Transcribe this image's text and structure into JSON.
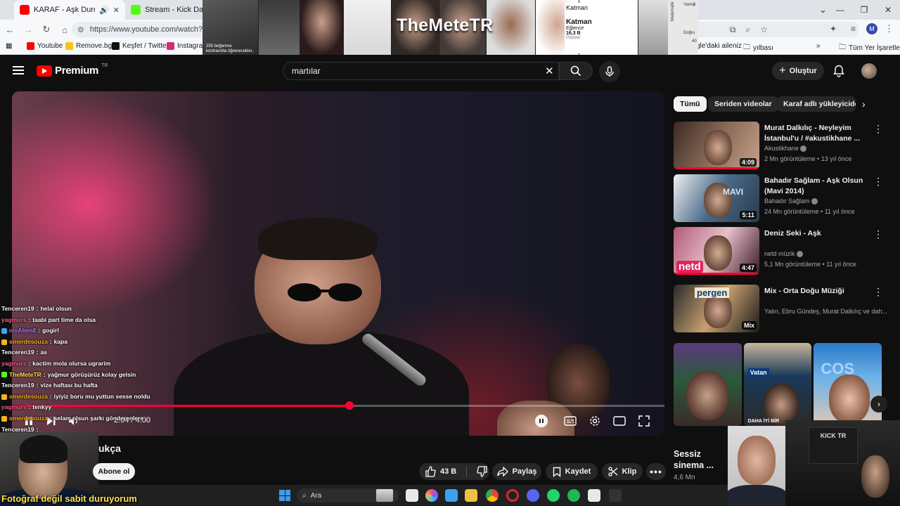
{
  "browser": {
    "tabs": [
      {
        "label": "KARAF - Aşk Durdukça - Yo",
        "active": true
      },
      {
        "label": "Stream - Kick Dashboa",
        "active": false
      }
    ],
    "url": "https://www.youtube.com/watch?v=fC",
    "bookmarks": [
      {
        "label": "Youtube"
      },
      {
        "label": "Remove.bg"
      },
      {
        "label": "Keşfet / Twitter"
      },
      {
        "label": "Instagram"
      },
      {
        "label": "gle'daki aileniz"
      },
      {
        "label": "yılbası"
      },
      {
        "label": "Tüm Yer İşaretleri"
      }
    ],
    "more_bookmarks": "»",
    "profile_initial": "M"
  },
  "overlay": {
    "brand": "TheMeteTR",
    "likes_text": "255 beğenme",
    "likes_sub": "kontravolta öğrenecekler..",
    "katman_top": "Katman",
    "katman_label": "Katman",
    "katman_sub": "Eğlence",
    "katman_count": "16,3 B",
    "katman_foot": "Popüler",
    "math_label": "Matematik",
    "math_col": "Yanlış",
    "math_col2": "Doğru",
    "math_v1": "0",
    "math_v2": "40"
  },
  "youtube": {
    "logo_text": "Premium",
    "region": "TR",
    "search_value": "martılar",
    "create_label": "Oluştur"
  },
  "player": {
    "timecode": "2:04 / 4:00",
    "progress_fraction": 0.517
  },
  "chat": [
    {
      "user": "Tenceren19",
      "msg": "helal olsun",
      "color": "#ffffff",
      "badge": ""
    },
    {
      "user": "yagmurs",
      "msg": "taabi part time da olsa",
      "color": "#ff5c8a",
      "badge": ""
    },
    {
      "user": "nisAben8",
      "msg": "gogirl",
      "color": "#b07cff",
      "badge": "#3ea6ff"
    },
    {
      "user": "omerdesouza",
      "msg": "kapa",
      "color": "#ffb020",
      "badge": "#ffb020"
    },
    {
      "user": "Tenceren19",
      "msg": "as",
      "color": "#ffffff",
      "badge": ""
    },
    {
      "user": "yagmurs",
      "msg": "kactim mola olursa ugrarim",
      "color": "#ff5c8a",
      "badge": ""
    },
    {
      "user": "TheMeteTR",
      "msg": "yağmur görüşürüz kolay gelsin",
      "color": "#ffe14a",
      "badge": "#53fc18"
    },
    {
      "user": "Tenceren19",
      "msg": "vize haftası bu hafta",
      "color": "#ffffff",
      "badge": ""
    },
    {
      "user": "omerdesouza",
      "msg": "iyiyiz boru mu yuttun sesse noldu",
      "color": "#ffb020",
      "badge": "#ffb020"
    },
    {
      "user": "yagmurs",
      "msg": "tenkyy",
      "color": "#ff5c8a",
      "badge": ""
    },
    {
      "user": "omerdesouza",
      "msg": "selam olsun şarkı gönderenlere",
      "color": "#ffb020",
      "badge": "#ffb020"
    },
    {
      "user": "Tenceren19",
      "msg": "",
      "color": "#ffffff",
      "badge": ""
    }
  ],
  "below_video": {
    "title_fragment": "ukça",
    "subscribe_label": "Abone ol",
    "likes": "43 B",
    "share_label": "Paylaş",
    "save_label": "Kaydet",
    "clip_label": "Klip"
  },
  "chips": [
    "Tümü",
    "Seriden videolar",
    "Karaf adlı yükleyiciden"
  ],
  "recommendations": [
    {
      "title": "Murat Dalkılıç - Neyleyim İstanbul'u / #akustikhane ...",
      "channel": "Akustikhane",
      "verified": true,
      "meta": "2 Mn görüntüleme • 13 yıl önce",
      "duration": "4:09",
      "watched": 1.0,
      "colors": [
        "#3a2a22",
        "#8a6a58",
        "#c7a28a"
      ]
    },
    {
      "title": "Bahadır Sağlam - Aşk Olsun (Mavi 2014)",
      "channel": "Bahadır Sağlam",
      "verified": true,
      "meta": "24 Mn görüntüleme • 11 yıl önce",
      "duration": "5:11",
      "watched": 0.0,
      "colors": [
        "#f0f0f0",
        "#4a6a8a",
        "#2a3a4a"
      ]
    },
    {
      "title": "Deniz Seki - Aşk",
      "channel": "netd müzik",
      "verified": true,
      "meta": "5,1 Mn görüntüleme • 11 yıl önce",
      "duration": "4:47",
      "watched": 1.0,
      "colors": [
        "#b05a7a",
        "#e8c0c8",
        "#3a1a2a"
      ]
    },
    {
      "title": "Mix - Orta Doğu Müziği",
      "channel": "Yalın, Ebru Gündeş, Murat Dalkılıç ve dah...",
      "verified": false,
      "meta": "",
      "duration": "Mix",
      "watched": 0.0,
      "colors": [
        "#2a2a2a",
        "#c8a070",
        "#1a1a1a"
      ]
    }
  ],
  "rec_thumb_texts": {
    "netd": "netd",
    "mavi": "MAVI",
    "pergen": "pergen"
  },
  "shorts": {
    "title": "Sessiz sinema ...",
    "views": "4,6 Mn",
    "thumb_texts": [
      "",
      "Vatan",
      "COŞ"
    ],
    "label_inner": "DAHA İYİ BİR"
  },
  "webcam": {
    "caption": "Fotoğraf değil sabit duruyorum",
    "kick_sign": "KICK TR"
  },
  "taskbar": {
    "search_label": "Ara"
  }
}
